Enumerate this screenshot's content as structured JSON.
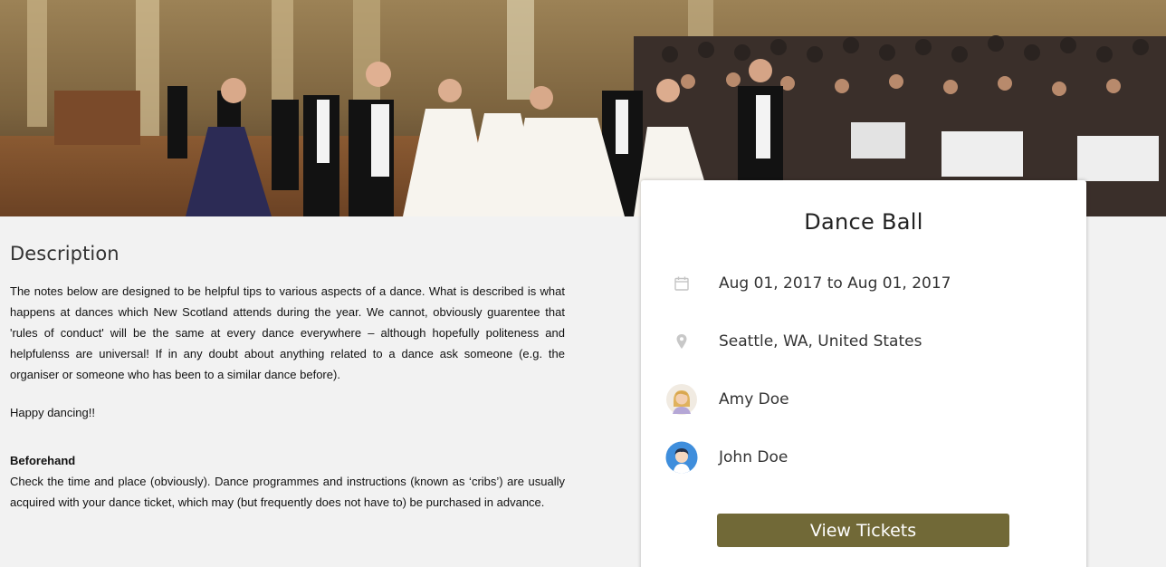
{
  "hero": {
    "image_alt": "ballroom dancers"
  },
  "description": {
    "heading": "Description",
    "intro": "The notes below are designed to be helpful tips to various aspects of a dance. What is described is what happens at dances which New Scotland attends during the year. We cannot, obviously guarentee that 'rules of conduct' will be the same at every dance everywhere – although hopefully politeness and helpfulenss are universal! If in any doubt about anything related to a dance ask someone (e.g. the organiser or someone who has been to a similar dance before).",
    "sign_off": "Happy dancing!!",
    "section_title": "Beforehand",
    "section_body": "Check the time and place (obviously). Dance programmes and instructions (known as ‘cribs’) are usually acquired with your dance ticket, which may (but frequently does not have to) be purchased in advance."
  },
  "event": {
    "title": "Dance Ball",
    "dates": "Aug 01, 2017 to Aug 01, 2017",
    "location": "Seattle, WA, United States",
    "hosts": [
      {
        "name": "Amy Doe",
        "icon": "female-avatar-icon"
      },
      {
        "name": "John Doe",
        "icon": "male-avatar-icon"
      }
    ],
    "cta_label": "View Tickets",
    "icons": {
      "date": "calendar-icon",
      "location": "map-pin-icon"
    }
  },
  "colors": {
    "button": "#716937",
    "background": "#f2f2f2",
    "card": "#ffffff"
  }
}
